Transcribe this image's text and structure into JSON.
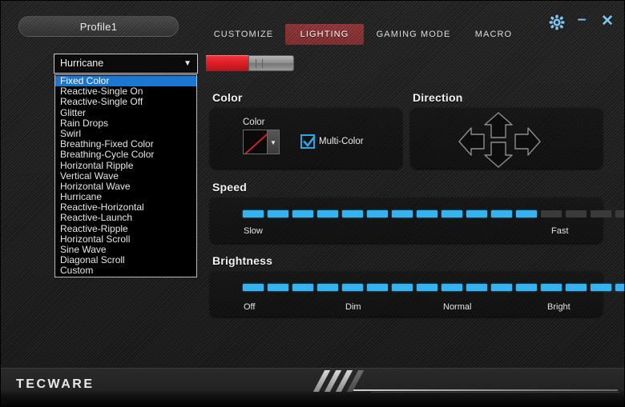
{
  "window": {
    "profile_tab_label": "Profile1",
    "controls": {
      "settings_icon": "gear-icon",
      "minimize_label": "–",
      "close_label": "✕"
    }
  },
  "tabs": [
    {
      "label": "CUSTOMIZE",
      "active": false
    },
    {
      "label": "LIGHTING",
      "active": true
    },
    {
      "label": "GAMING MODE",
      "active": false
    },
    {
      "label": "MACRO",
      "active": false
    }
  ],
  "effect_selector": {
    "selected_value": "Hurricane",
    "chevron": "▼",
    "options": [
      "Fixed Color",
      "Reactive-Single On",
      "Reactive-Single Off",
      "Glitter",
      "Rain Drops",
      "Swirl",
      "Breathing-Fixed Color",
      "Breathing-Cycle Color",
      "Horizontal Ripple",
      "Vertical Wave",
      "Horizontal Wave",
      "Hurricane",
      "Reactive-Horizontal",
      "Reactive-Launch",
      "Reactive-Ripple",
      "Horizontal Scroll",
      "Sine Wave",
      "Diagonal Scroll",
      "Custom"
    ],
    "highlighted_option": "Fixed Color",
    "highlight_color": "#1b77d2"
  },
  "color_section": {
    "title": "Color",
    "color_label": "Color",
    "swatch_color": "#0a0a0a",
    "swatch_slash_color": "#cc2127",
    "swatch_dropdown_chevron": "▼",
    "multi_color_label": "Multi-Color",
    "multi_color_checked": true,
    "checkbox_accent": "#29a8e8"
  },
  "direction_section": {
    "title": "Direction",
    "buttons": [
      "arrow-up",
      "arrow-down",
      "arrow-left",
      "arrow-right"
    ]
  },
  "speed_section": {
    "title": "Speed",
    "min_label": "Slow",
    "max_label": "Fast",
    "segments_total": 16,
    "segments_lit": 12,
    "lit_color": "#35b3f0",
    "unlit_color": "#3a3a3a"
  },
  "brightness_section": {
    "title": "Brightness",
    "labels": [
      "Off",
      "Dim",
      "Normal",
      "Bright"
    ],
    "segments_total": 16,
    "segments_lit": 16,
    "lit_color": "#35b3f0",
    "unlit_color": "#3a3a3a"
  },
  "footer": {
    "brand": "TECWARE"
  }
}
